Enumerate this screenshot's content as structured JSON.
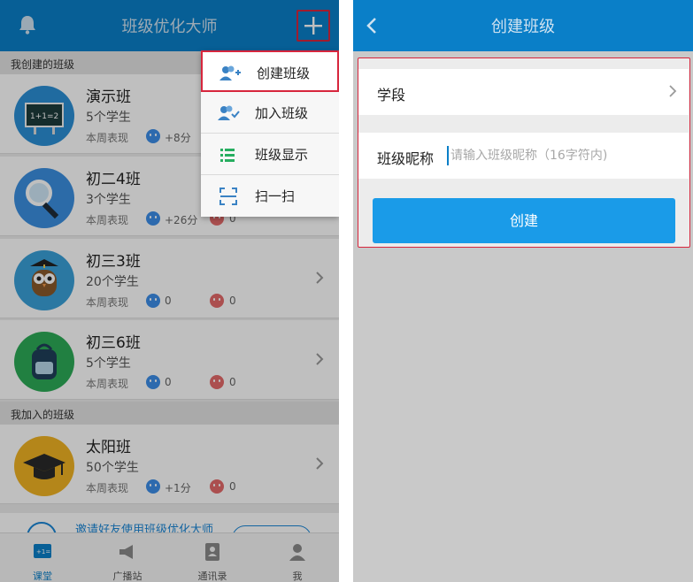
{
  "left": {
    "title": "班级优化大师",
    "sections": {
      "created": "我创建的班级",
      "joined": "我加入的班级"
    },
    "classes": [
      {
        "name": "演示班",
        "students": "5个学生",
        "perf_label": "本周表现",
        "positive": "+8分",
        "negative": null
      },
      {
        "name": "初二4班",
        "students": "3个学生",
        "perf_label": "本周表现",
        "positive": "+26分",
        "negative": "0"
      },
      {
        "name": "初三3班",
        "students": "20个学生",
        "perf_label": "本周表现",
        "positive": "0",
        "negative": "0"
      },
      {
        "name": "初三6班",
        "students": "5个学生",
        "perf_label": "本周表现",
        "positive": "0",
        "negative": "0"
      },
      {
        "name": "太阳班",
        "students": "50个学生",
        "perf_label": "本周表现",
        "positive": "+1分",
        "negative": "0"
      }
    ],
    "invite_text": "邀请好友使用班级优化大师",
    "menu": [
      {
        "label": "创建班级",
        "icon": "add-user-icon"
      },
      {
        "label": "加入班级",
        "icon": "join-group-icon"
      },
      {
        "label": "班级显示",
        "icon": "list-icon"
      },
      {
        "label": "扫一扫",
        "icon": "scan-icon"
      }
    ],
    "tabs": [
      {
        "label": "课堂",
        "icon": "classroom-icon"
      },
      {
        "label": "广播站",
        "icon": "megaphone-icon"
      },
      {
        "label": "通讯录",
        "icon": "contacts-icon"
      },
      {
        "label": "我",
        "icon": "person-icon"
      }
    ]
  },
  "right": {
    "title": "创建班级",
    "stage_label": "学段",
    "nickname_label": "班级昵称",
    "nickname_placeholder": "请输入班级昵称（16字符内)",
    "create_label": "创建"
  },
  "colors": {
    "header_blue": "#0a7fc8",
    "button_blue": "#1a9be8",
    "highlight_red": "#d7263d"
  }
}
